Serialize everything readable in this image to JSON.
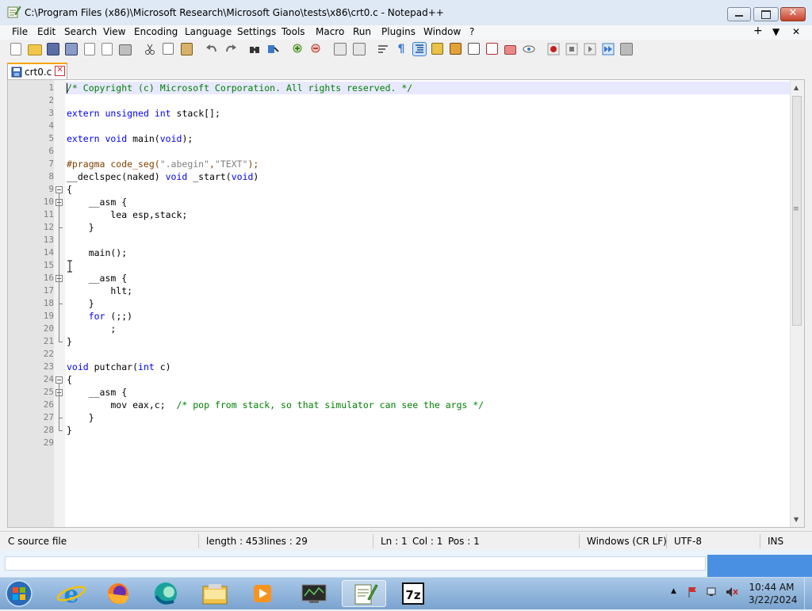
{
  "window": {
    "title": "C:\\Program Files (x86)\\Microsoft Research\\Microsoft Giano\\tests\\x86\\crt0.c - Notepad++",
    "icon": "notepadpp-icon",
    "controls": [
      "minimize",
      "maximize",
      "close"
    ]
  },
  "menu": {
    "items": [
      "File",
      "Edit",
      "Search",
      "View",
      "Encoding",
      "Language",
      "Settings",
      "Tools",
      "Macro",
      "Run",
      "Plugins",
      "Window",
      "?"
    ],
    "right": [
      "+",
      "▼",
      "✕"
    ]
  },
  "toolbar": {
    "icons": [
      "new-file-icon",
      "open-file-icon",
      "save-icon",
      "save-all-icon",
      "close-icon",
      "close-all-icon",
      "print-icon",
      "cut-icon",
      "copy-icon",
      "paste-icon",
      "undo-icon",
      "redo-icon",
      "find-icon",
      "replace-icon",
      "zoom-in-icon",
      "zoom-out-icon",
      "sync-vertical-icon",
      "sync-horizontal-icon",
      "word-wrap-icon",
      "show-all-chars-icon",
      "indent-guide-icon",
      "udl-icon",
      "doc-map-icon",
      "function-list-icon",
      "folder-as-workspace-icon",
      "monitoring-icon",
      "record-macro-icon",
      "stop-macro-icon",
      "play-macro-icon",
      "run-macro-multiple-icon",
      "save-macro-icon"
    ]
  },
  "tab": {
    "label": "crt0.c"
  },
  "editor": {
    "lines": [
      "/* Copyright (c) Microsoft Corporation. All rights reserved. */",
      "",
      "extern unsigned int stack[];",
      "",
      "extern void main(void);",
      "",
      "#pragma code_seg(\".abegin\",\"TEXT\");",
      "__declspec(naked) void _start(void)",
      "{",
      "    __asm {",
      "        lea esp,stack;",
      "    }",
      "",
      "    main();",
      "",
      "    __asm {",
      "        hlt;",
      "    }",
      "    for (;;)",
      "        ;",
      "}",
      "",
      "void putchar(int c)",
      "{",
      "    __asm {",
      "        mov eax,c;  /* pop from stack, so that simulator can see the args */",
      "    }",
      "}",
      ""
    ],
    "line_numbers": [
      "1",
      "2",
      "3",
      "4",
      "5",
      "6",
      "7",
      "8",
      "9",
      "10",
      "11",
      "12",
      "13",
      "14",
      "15",
      "16",
      "17",
      "18",
      "19",
      "20",
      "21",
      "22",
      "23",
      "24",
      "25",
      "26",
      "27",
      "28",
      "29"
    ],
    "current_line": 1
  },
  "status": {
    "file_type": "C source file",
    "length": "length : 453",
    "lines": "lines : 29",
    "ln": "Ln : 1",
    "col": "Col : 1",
    "pos": "Pos : 1",
    "eol": "Windows (CR LF)",
    "encoding": "UTF-8",
    "mode": "INS"
  },
  "taskbar": {
    "items": [
      "start-button",
      "internet-explorer-icon",
      "firefox-icon",
      "edge-icon",
      "file-explorer-icon",
      "media-player-icon",
      "network-monitor-icon",
      "notepadpp-icon",
      "7zip-icon"
    ],
    "active": "notepadpp-icon",
    "clock_time": "10:44 AM",
    "clock_date": "3/22/2024",
    "tray": [
      "tray-arrow-icon",
      "tray-flag-icon",
      "tray-network-icon",
      "tray-volume-icon"
    ]
  },
  "colors": {
    "keyword": "#0000ff",
    "comment": "#008000",
    "preprocessor": "#804000",
    "string": "#808080",
    "current_line": "#e8e8ff"
  }
}
